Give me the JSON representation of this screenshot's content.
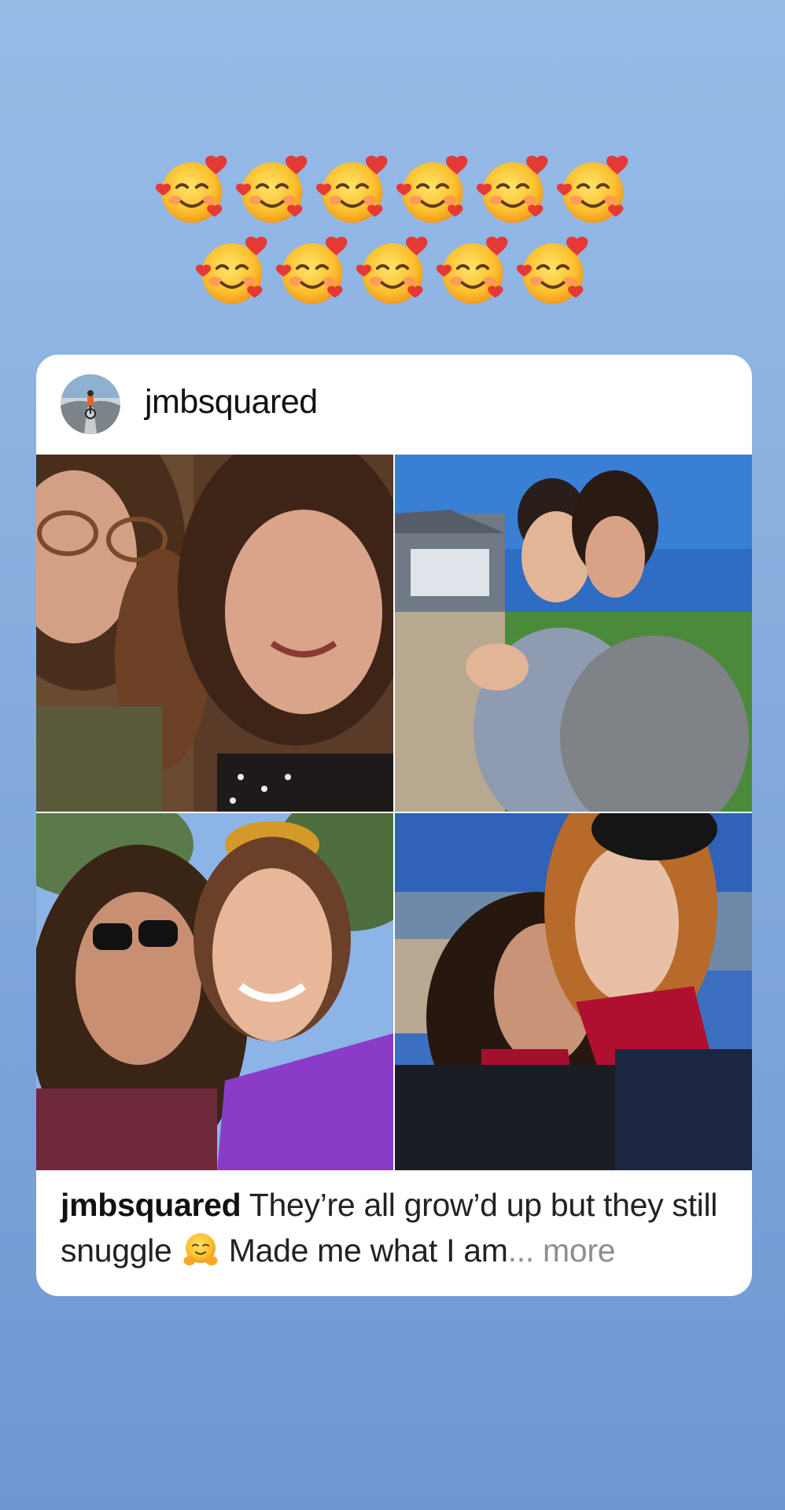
{
  "sticker": {
    "emoji_name": "smiling-face-with-hearts",
    "row1_count": 6,
    "row2_count": 5
  },
  "post": {
    "username": "jmbsquared",
    "caption_user": "jmbsquared",
    "caption_text_1": " They’re all grow’d up but they still snuggle ",
    "caption_emoji": "hugging-face",
    "caption_text_2": " Made me what I am",
    "caption_ellipsis": "...",
    "more_label": " more"
  },
  "photos": [
    {
      "name": "photo-indoor-selfie"
    },
    {
      "name": "photo-hug-outdoors"
    },
    {
      "name": "photo-sunglasses-selfie"
    },
    {
      "name": "photo-beach-selfie"
    }
  ],
  "colors": {
    "background_top": "#97bce8",
    "background_bottom": "#6f98d2",
    "card": "#ffffff",
    "more_text": "#8e8e8e"
  }
}
